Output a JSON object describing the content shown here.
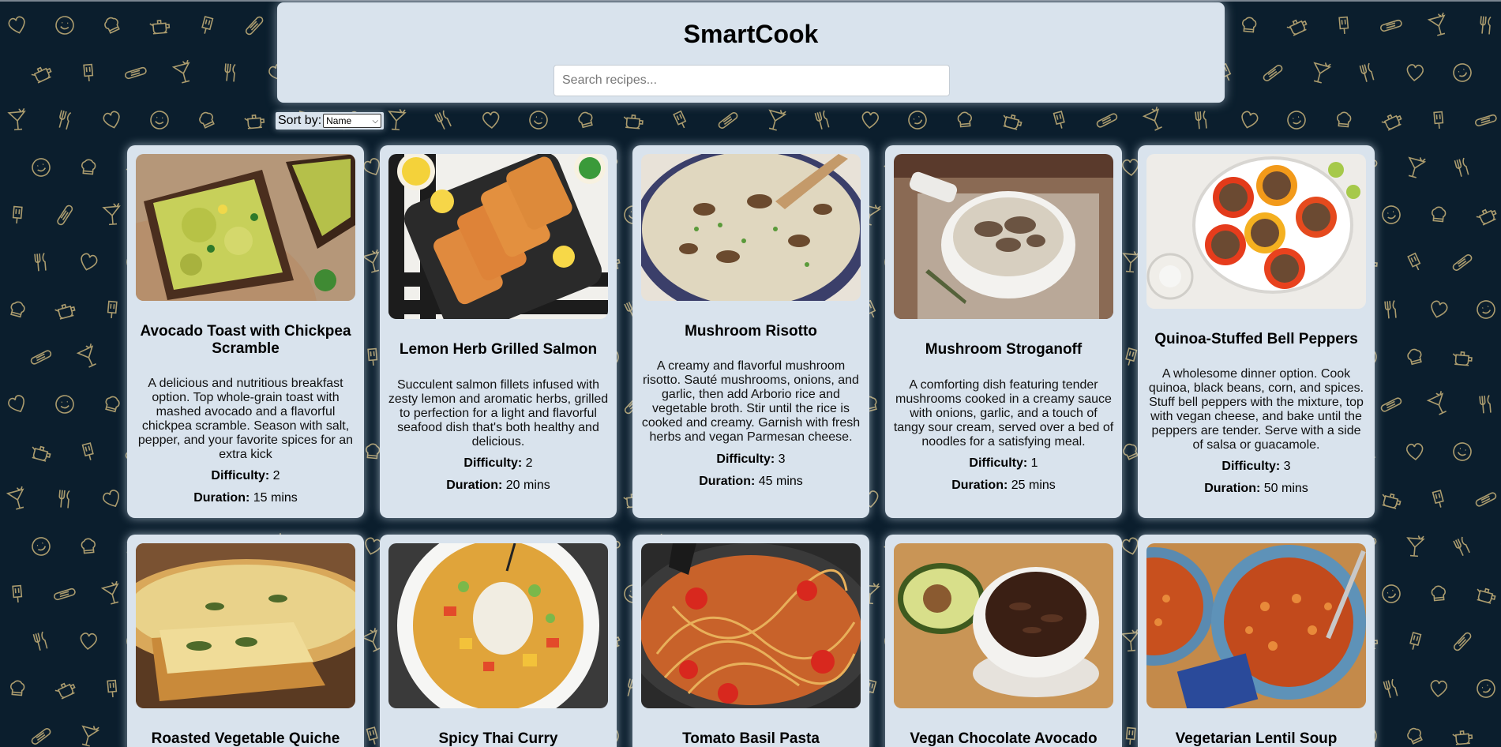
{
  "app": {
    "title": "SmartCook"
  },
  "search": {
    "placeholder": "Search recipes..."
  },
  "sort": {
    "label": "Sort by:",
    "selected": "Name"
  },
  "labels": {
    "difficulty": "Difficulty:",
    "duration": "Duration:"
  },
  "colors": {
    "background": "#0b1e2d",
    "panel": "#d9e3ed",
    "pattern": "#c8b27a"
  },
  "recipes": [
    {
      "title": "Avocado Toast with Chickpea Scramble",
      "description": "A delicious and nutritious breakfast option. Top whole-grain toast with mashed avocado and a flavorful chickpea scramble. Season with salt, pepper, and your favorite spices for an extra kick",
      "difficulty": "2",
      "duration": "15 mins",
      "image": "avocado-toast-photo"
    },
    {
      "title": "Lemon Herb Grilled Salmon",
      "description": "Succulent salmon fillets infused with zesty lemon and aromatic herbs, grilled to perfection for a light and flavorful seafood dish that's both healthy and delicious.",
      "difficulty": "2",
      "duration": "20 mins",
      "image": "grilled-salmon-photo"
    },
    {
      "title": "Mushroom Risotto",
      "description": "A creamy and flavorful mushroom risotto. Sauté mushrooms, onions, and garlic, then add Arborio rice and vegetable broth. Stir until the rice is cooked and creamy. Garnish with fresh herbs and vegan Parmesan cheese.",
      "difficulty": "3",
      "duration": "45 mins",
      "image": "mushroom-risotto-photo"
    },
    {
      "title": "Mushroom Stroganoff",
      "description": "A comforting dish featuring tender mushrooms cooked in a creamy sauce with onions, garlic, and a touch of tangy sour cream, served over a bed of noodles for a satisfying meal.",
      "difficulty": "1",
      "duration": "25 mins",
      "image": "mushroom-stroganoff-photo"
    },
    {
      "title": "Quinoa-Stuffed Bell Peppers",
      "description": "A wholesome dinner option. Cook quinoa, black beans, corn, and spices. Stuff bell peppers with the mixture, top with vegan cheese, and bake until the peppers are tender. Serve with a side of salsa or guacamole.",
      "difficulty": "3",
      "duration": "50 mins",
      "image": "stuffed-peppers-photo"
    },
    {
      "title": "Roasted Vegetable Quiche",
      "image": "quiche-photo"
    },
    {
      "title": "Spicy Thai Curry",
      "image": "thai-curry-photo"
    },
    {
      "title": "Tomato Basil Pasta",
      "image": "tomato-pasta-photo"
    },
    {
      "title": "Vegan Chocolate Avocado",
      "image": "chocolate-avocado-photo"
    },
    {
      "title": "Vegetarian Lentil Soup",
      "image": "lentil-soup-photo"
    }
  ]
}
